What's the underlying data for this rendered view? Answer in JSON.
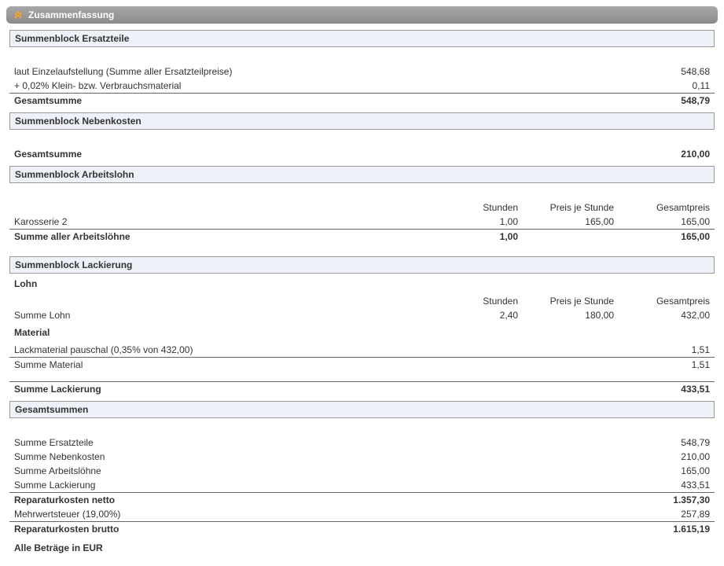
{
  "header": {
    "title": "Zusammenfassung"
  },
  "ersatzteile": {
    "title": "Summenblock Ersatzteile",
    "row1_label": "laut Einzelaufstellung (Summe aller Ersatzteilpreise)",
    "row1_value": "548,68",
    "row2_label": "+ 0,02% Klein- bzw. Verbrauchsmaterial",
    "row2_value": "0,11",
    "total_label": "Gesamtsumme",
    "total_value": "548,79"
  },
  "nebenkosten": {
    "title": "Summenblock Nebenkosten",
    "total_label": "Gesamtsumme",
    "total_value": "210,00"
  },
  "arbeitslohn": {
    "title": "Summenblock Arbeitslohn",
    "col_stunden": "Stunden",
    "col_preis": "Preis je Stunde",
    "col_gesamt": "Gesamtpreis",
    "row1_label": "Karosserie 2",
    "row1_stunden": "1,00",
    "row1_preis": "165,00",
    "row1_gesamt": "165,00",
    "total_label": "Summe aller Arbeitslöhne",
    "total_stunden": "1,00",
    "total_gesamt": "165,00"
  },
  "lackierung": {
    "title": "Summenblock Lackierung",
    "lohn_title": "Lohn",
    "col_stunden": "Stunden",
    "col_preis": "Preis je Stunde",
    "col_gesamt": "Gesamtpreis",
    "lohn_row_label": "Summe Lohn",
    "lohn_row_stunden": "2,40",
    "lohn_row_preis": "180,00",
    "lohn_row_gesamt": "432,00",
    "material_title": "Material",
    "material_row_label": "Lackmaterial pauschal (0,35% von 432,00)",
    "material_row_value": "1,51",
    "material_total_label": "Summe Material",
    "material_total_value": "1,51",
    "total_label": "Summe Lackierung",
    "total_value": "433,51"
  },
  "gesamtsummen": {
    "title": "Gesamtsummen",
    "row1_label": "Summe Ersatzteile",
    "row1_value": "548,79",
    "row2_label": "Summe Nebenkosten",
    "row2_value": "210,00",
    "row3_label": "Summe Arbeitslöhne",
    "row3_value": "165,00",
    "row4_label": "Summe Lackierung",
    "row4_value": "433,51",
    "netto_label": "Reparaturkosten netto",
    "netto_value": "1.357,30",
    "mwst_label": "Mehrwertsteuer (19,00%)",
    "mwst_value": "257,89",
    "brutto_label": "Reparaturkosten brutto",
    "brutto_value": "1.615,19"
  },
  "footnote": "Alle Beträge in EUR"
}
